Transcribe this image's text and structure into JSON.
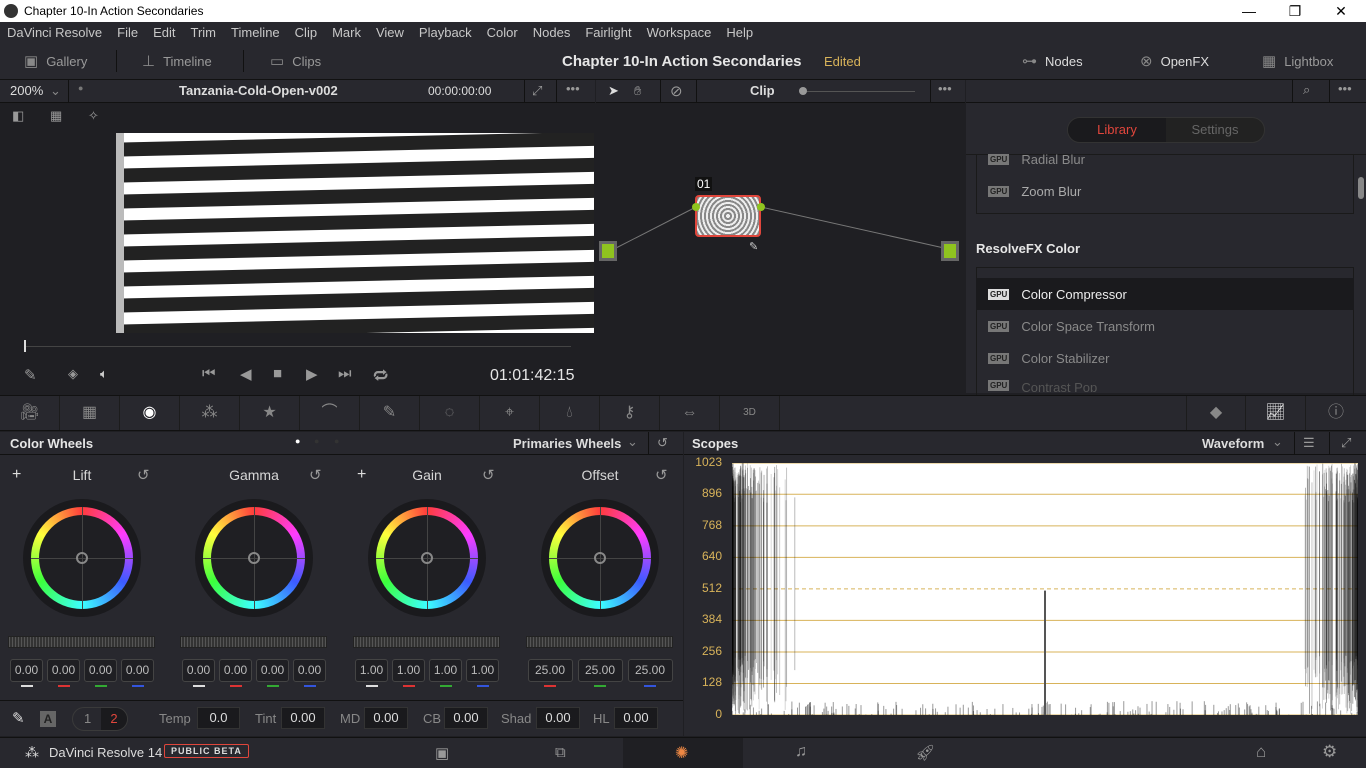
{
  "window": {
    "title": "Chapter 10-In Action Secondaries",
    "controls": [
      "—",
      "❐",
      "✕"
    ]
  },
  "menu": [
    "DaVinci Resolve",
    "File",
    "Edit",
    "Trim",
    "Timeline",
    "Clip",
    "Mark",
    "View",
    "Playback",
    "Color",
    "Nodes",
    "Fairlight",
    "Workspace",
    "Help"
  ],
  "toolbar": {
    "gallery": "Gallery",
    "timeline": "Timeline",
    "clips": "Clips",
    "project_title": "Chapter 10-In Action Secondaries",
    "edited": "Edited",
    "nodes": "Nodes",
    "openfx": "OpenFX",
    "lightbox": "Lightbox"
  },
  "viewer": {
    "zoom": "200%",
    "clip_name": "Tanzania-Cold-Open-v002",
    "timecode_top": "00:00:00:00",
    "timecode": "01:01:42:15",
    "playhead_fraction": 0.0
  },
  "nodes": {
    "mode": "Clip",
    "node_label": "01"
  },
  "library": {
    "tabs": {
      "library": "Library",
      "settings": "Settings"
    },
    "active_tab": "Library",
    "group1_items": [
      "Radial Blur",
      "Zoom Blur"
    ],
    "group2_title": "ResolveFX Color",
    "group2_items": [
      "Color Compressor",
      "Color Space Transform",
      "Color Stabilizer",
      "Contrast Pop"
    ],
    "selected": "Color Compressor",
    "gpu_badge": "GPU"
  },
  "color_wheels": {
    "title": "Color Wheels",
    "mode": "Primaries Wheels",
    "wheels": [
      {
        "label": "Lift",
        "values": [
          "0.00",
          "0.00",
          "0.00",
          "0.00"
        ]
      },
      {
        "label": "Gamma",
        "values": [
          "0.00",
          "0.00",
          "0.00",
          "0.00"
        ]
      },
      {
        "label": "Gain",
        "values": [
          "1.00",
          "1.00",
          "1.00",
          "1.00"
        ]
      },
      {
        "label": "Offset",
        "values": [
          "25.00",
          "25.00",
          "25.00"
        ]
      }
    ],
    "auto": "A",
    "page1": "1",
    "page2": "2",
    "adjust": [
      {
        "label": "Temp",
        "value": "0.0"
      },
      {
        "label": "Tint",
        "value": "0.00"
      },
      {
        "label": "MD",
        "value": "0.00"
      },
      {
        "label": "CB",
        "value": "0.00"
      },
      {
        "label": "Shad",
        "value": "0.00"
      },
      {
        "label": "HL",
        "value": "0.00"
      }
    ]
  },
  "scopes": {
    "title": "Scopes",
    "mode": "Waveform",
    "y_ticks": [
      "1023",
      "896",
      "768",
      "640",
      "512",
      "384",
      "256",
      "128",
      "0"
    ]
  },
  "status": {
    "app": "DaVinci Resolve 14",
    "badge": "PUBLIC BETA"
  },
  "colors": {
    "accent_red": "#e0463c",
    "edited_gold": "#d8b35a",
    "node_green": "#8fc31f",
    "panel": "#28282e"
  }
}
